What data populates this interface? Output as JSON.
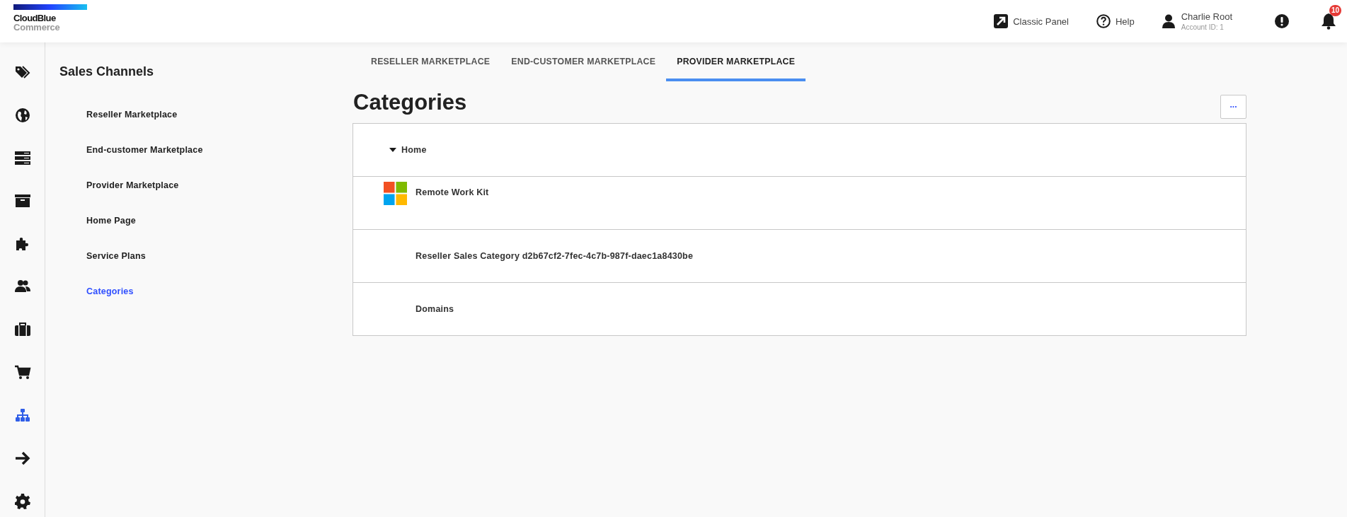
{
  "logo": {
    "line_1": "CloudBlue",
    "line_2": "Commerce"
  },
  "header": {
    "classic_panel": "Classic Panel",
    "help": "Help",
    "user_name": "Charlie Root",
    "account_id": "Account ID: 1",
    "notification_count": "10"
  },
  "rail": [
    {
      "kind": "tags",
      "selected": false
    },
    {
      "kind": "globe",
      "selected": false
    },
    {
      "kind": "servers",
      "selected": false
    },
    {
      "kind": "archive",
      "selected": false
    },
    {
      "kind": "puzzle",
      "selected": false
    },
    {
      "kind": "users",
      "selected": false
    },
    {
      "kind": "briefcase",
      "selected": false
    },
    {
      "kind": "cart",
      "selected": false
    },
    {
      "kind": "sitemap",
      "selected": true
    },
    {
      "kind": "arrow",
      "selected": false
    },
    {
      "kind": "gear",
      "selected": false
    }
  ],
  "sidebar": {
    "title": "Sales Channels",
    "items": [
      {
        "label": "Reseller Marketplace",
        "selected": false
      },
      {
        "label": "End-customer Marketplace",
        "selected": false
      },
      {
        "label": "Provider Marketplace",
        "selected": false
      },
      {
        "label": "Home Page",
        "selected": false
      },
      {
        "label": "Service Plans",
        "selected": false
      },
      {
        "label": "Categories",
        "selected": true
      }
    ]
  },
  "tabs": [
    {
      "label": "RESELLER MARKETPLACE",
      "selected": false
    },
    {
      "label": "END-CUSTOMER MARKETPLACE",
      "selected": false
    },
    {
      "label": "PROVIDER MARKETPLACE",
      "selected": true
    }
  ],
  "page": {
    "title": "Categories",
    "more_button": "..."
  },
  "tree": [
    {
      "label": "Home",
      "expanded": true,
      "children": [
        {
          "label": "Remote Work Kit",
          "kind": "logo"
        },
        {
          "label": "Reseller Sales Category d2b67cf2-7fec-4c7b-987f-daec1a8430be",
          "kind": "plain"
        },
        {
          "label": "Domains",
          "kind": "plain"
        }
      ]
    }
  ]
}
